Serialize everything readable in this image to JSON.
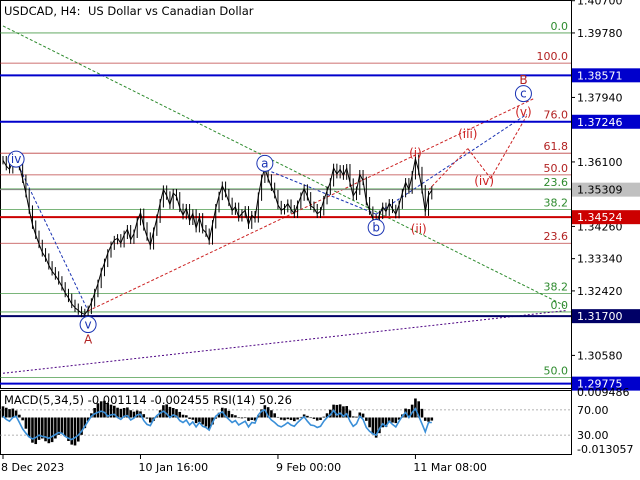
{
  "header": {
    "symbol": "USDCAD, H4:",
    "description": "US Dollar vs Canadian Dollar"
  },
  "price_axis": {
    "ticks": [
      "1.40700",
      "1.39780",
      "1.37940",
      "1.36100",
      "1.34260",
      "1.33340",
      "1.32420",
      "1.30580"
    ],
    "tick_values": [
      1.407,
      1.3978,
      1.3794,
      1.361,
      1.3426,
      1.3334,
      1.3242,
      1.3058
    ],
    "range": [
      1.2965,
      1.4072
    ]
  },
  "time_axis": {
    "labels": [
      "8 Dec 2023",
      "10 Jan 16:00",
      "9 Feb 00:00",
      "11 Mar 08:00"
    ],
    "label_bars": [
      0,
      42,
      84,
      126
    ]
  },
  "levels": [
    {
      "name": "upper-blue-level",
      "value": 1.38571,
      "label": "1.38571",
      "color": "#0000cc",
      "style": "thick"
    },
    {
      "name": "lower-blue-level-1",
      "value": 1.37246,
      "label": "1.37246",
      "color": "#0000cc",
      "style": "thick"
    },
    {
      "name": "red-level",
      "value": 1.34524,
      "label": "1.34524",
      "color": "#cc0000",
      "style": "thick"
    },
    {
      "name": "navy-level-1",
      "value": 1.317,
      "label": "1.31700",
      "color": "#000066",
      "style": "thick"
    },
    {
      "name": "navy-level-2",
      "value": 1.29775,
      "label": "1.29775",
      "color": "#0000cc",
      "style": "thick"
    },
    {
      "name": "bid-level",
      "value": 1.35309,
      "label": "1.35309",
      "color": "#888888",
      "style": "thin"
    }
  ],
  "fibo_labels": [
    {
      "text": "0.0",
      "value": 1.3978,
      "color": "#2e8b2e"
    },
    {
      "text": "100.0",
      "value": 1.3892,
      "color": "#b22222"
    },
    {
      "text": "76.0",
      "value": 1.3725,
      "color": "#b22222"
    },
    {
      "text": "61.8",
      "value": 1.3635,
      "color": "#b22222"
    },
    {
      "text": "50.0",
      "value": 1.3573,
      "color": "#b22222"
    },
    {
      "text": "23.6",
      "value": 1.3533,
      "color": "#2e8b2e"
    },
    {
      "text": "38.2",
      "value": 1.3474,
      "color": "#2e8b2e"
    },
    {
      "text": "23.6",
      "value": 1.3378,
      "color": "#b22222"
    },
    {
      "text": "38.2",
      "value": 1.3235,
      "color": "#2e8b2e"
    },
    {
      "text": "0.0",
      "value": 1.3182,
      "color": "#2e8b2e"
    },
    {
      "text": "50.0",
      "value": 1.2995,
      "color": "#2e8b2e"
    }
  ],
  "wave_labels": [
    {
      "text": "iv",
      "bar": 4,
      "value": 1.3618,
      "color": "#1a33b3",
      "circled": true
    },
    {
      "text": "v",
      "bar": 26,
      "value": 1.3146,
      "color": "#1a33b3",
      "circled": true
    },
    {
      "text": "A",
      "bar": 26,
      "value": 1.3104,
      "color": "#b22222",
      "circled": false
    },
    {
      "text": "a",
      "bar": 80,
      "value": 1.3606,
      "color": "#1a33b3",
      "circled": true
    },
    {
      "text": "b",
      "bar": 114,
      "value": 1.3423,
      "color": "#1a33b3",
      "circled": true
    },
    {
      "text": "(i)",
      "bar": 126,
      "value": 1.3635,
      "color": "#cc2222",
      "circled": false
    },
    {
      "text": "(ii)",
      "bar": 127,
      "value": 1.3418,
      "color": "#cc2222",
      "circled": false
    },
    {
      "text": "(iii)",
      "bar": 142,
      "value": 1.3689,
      "color": "#cc2222",
      "circled": false
    },
    {
      "text": "(iv)",
      "bar": 147,
      "value": 1.3556,
      "color": "#cc2222",
      "circled": false
    },
    {
      "text": "(v)",
      "bar": 159,
      "value": 1.3753,
      "color": "#cc2222",
      "circled": false
    },
    {
      "text": "B",
      "bar": 159,
      "value": 1.3844,
      "color": "#b22222",
      "circled": false
    },
    {
      "text": "c",
      "bar": 159,
      "value": 1.3805,
      "color": "#1a33b3",
      "circled": true
    }
  ],
  "chart_data": {
    "type": "line",
    "title": "USDCAD, H4: US Dollar vs Canadian Dollar",
    "xlabel": "",
    "ylabel": "",
    "grid": false,
    "x_ticks": [
      "8 Dec 2023",
      "10 Jan 16:00",
      "9 Feb 00:00",
      "11 Mar 08:00"
    ],
    "ylim": [
      1.2965,
      1.4072
    ],
    "series": [
      {
        "values": [
          1.3615,
          1.3598,
          1.3589,
          1.3612,
          1.3625,
          1.3598,
          1.3562,
          1.3521,
          1.3474,
          1.3431,
          1.3402,
          1.3376,
          1.3352,
          1.3337,
          1.3315,
          1.3298,
          1.3286,
          1.3272,
          1.3255,
          1.3236,
          1.3222,
          1.3205,
          1.3194,
          1.3186,
          1.3179,
          1.3175,
          1.3188,
          1.3209,
          1.3236,
          1.3262,
          1.3296,
          1.3322,
          1.3349,
          1.3371,
          1.3387,
          1.3392,
          1.3378,
          1.3402,
          1.3418,
          1.3388,
          1.3405,
          1.3441,
          1.3465,
          1.3426,
          1.3397,
          1.3372,
          1.3411,
          1.3448,
          1.3492,
          1.3531,
          1.3514,
          1.3488,
          1.3521,
          1.3512,
          1.3479,
          1.3458,
          1.3478,
          1.3442,
          1.3463,
          1.3421,
          1.3452,
          1.3418,
          1.3408,
          1.3386,
          1.3432,
          1.3478,
          1.3513,
          1.3542,
          1.3521,
          1.3496,
          1.3471,
          1.3482,
          1.3452,
          1.3463,
          1.3472,
          1.3431,
          1.3458,
          1.3449,
          1.3511,
          1.3562,
          1.3592,
          1.3563,
          1.3539,
          1.3518,
          1.3487,
          1.3472,
          1.3478,
          1.3491,
          1.3475,
          1.3462,
          1.3488,
          1.3511,
          1.3534,
          1.3512,
          1.3485,
          1.3478,
          1.3462,
          1.3469,
          1.3501,
          1.3528,
          1.3552,
          1.3593,
          1.3575,
          1.3589,
          1.3571,
          1.3592,
          1.3551,
          1.3513,
          1.3528,
          1.3575,
          1.3556,
          1.3498,
          1.3471,
          1.3448,
          1.3433,
          1.3459,
          1.3482,
          1.3468,
          1.3492,
          1.3476,
          1.3461,
          1.3488,
          1.3521,
          1.3552,
          1.3531,
          1.3572,
          1.3619,
          1.3584,
          1.3532,
          1.3468,
          1.3515,
          1.3529
        ]
      }
    ],
    "reference_lines": [
      {
        "value": 1.38571,
        "label": "1.38571"
      },
      {
        "value": 1.37246,
        "label": "1.37246"
      },
      {
        "value": 1.35309,
        "label": "1.35309"
      },
      {
        "value": 1.34524,
        "label": "1.34524"
      },
      {
        "value": 1.317,
        "label": "1.31700"
      },
      {
        "value": 1.29775,
        "label": "1.29775"
      }
    ]
  },
  "macd_panel": {
    "label": "MACD(5,34,5) -0.001114 -0.002455 RSI(14) 50.26",
    "ticks": [
      "0.009486",
      "70.00",
      "30.00",
      "-0.013057"
    ],
    "macd_range": [
      -0.013057,
      0.009486
    ],
    "rsi_levels": [
      70,
      30
    ],
    "histogram": [
      0.004,
      0.0035,
      0.003,
      0.0032,
      0.0025,
      0.001,
      -0.001,
      -0.004,
      -0.007,
      -0.009,
      -0.0095,
      -0.008,
      -0.0075,
      -0.0085,
      -0.0092,
      -0.0088,
      -0.0075,
      -0.0062,
      -0.0055,
      -0.0068,
      -0.0084,
      -0.0097,
      -0.01,
      -0.0086,
      -0.0062,
      -0.0038,
      -0.0012,
      0.0015,
      0.0034,
      0.0051,
      0.0058,
      0.006,
      0.0052,
      0.0046,
      0.0042,
      0.0035,
      0.0031,
      0.0034,
      0.0036,
      0.0026,
      0.0021,
      0.0025,
      0.0022,
      0.0012,
      -0.0004,
      -0.0018,
      -0.0012,
      0.0004,
      0.0026,
      0.0044,
      0.0047,
      0.0038,
      0.0034,
      0.003,
      0.002,
      0.001,
      0.0008,
      -0.0005,
      -0.0008,
      -0.002,
      -0.0016,
      -0.0025,
      -0.0032,
      -0.0041,
      -0.0025,
      -0.0004,
      0.0017,
      0.0035,
      0.0033,
      0.0024,
      0.0012,
      0.0008,
      -0.0002,
      -0.0003,
      -0.0002,
      -0.0012,
      -0.0009,
      -0.0011,
      0.0008,
      0.0029,
      0.0044,
      0.0037,
      0.0026,
      0.0015,
      0.0002,
      -0.0008,
      -0.001,
      -0.0006,
      -0.0009,
      -0.0013,
      -0.0007,
      0.0002,
      0.0011,
      0.0006,
      -0.0002,
      -0.0005,
      -0.0011,
      -0.0009,
      0.0003,
      0.0015,
      0.0028,
      0.0046,
      0.0045,
      0.0047,
      0.004,
      0.0041,
      0.0025,
      0.0004,
      0.0003,
      0.0018,
      0.0014,
      -0.0012,
      -0.0035,
      -0.006,
      -0.0072,
      -0.0056,
      -0.0035,
      -0.0034,
      -0.0018,
      -0.0018,
      -0.002,
      -0.0008,
      0.0011,
      0.0032,
      0.003,
      0.0046,
      0.0068,
      0.0058,
      0.0031,
      -0.0012,
      -0.0015,
      -0.0011
    ],
    "rsi": [
      60,
      55,
      52,
      58,
      60,
      50,
      40,
      33,
      27,
      24,
      26,
      30,
      28,
      27,
      25,
      28,
      31,
      34,
      33,
      28,
      25,
      23,
      26,
      30,
      36,
      44,
      52,
      60,
      64,
      66,
      68,
      66,
      60,
      62,
      63,
      58,
      55,
      60,
      61,
      54,
      57,
      62,
      63,
      53,
      47,
      45,
      55,
      61,
      65,
      68,
      64,
      58,
      62,
      60,
      53,
      50,
      54,
      46,
      51,
      43,
      50,
      44,
      42,
      38,
      50,
      60,
      64,
      67,
      60,
      55,
      50,
      53,
      46,
      49,
      52,
      43,
      50,
      49,
      62,
      68,
      70,
      60,
      54,
      50,
      45,
      43,
      46,
      50,
      46,
      44,
      50,
      55,
      59,
      52,
      46,
      45,
      42,
      44,
      52,
      58,
      62,
      69,
      62,
      65,
      60,
      64,
      52,
      44,
      48,
      60,
      55,
      42,
      36,
      32,
      30,
      40,
      48,
      44,
      52,
      47,
      43,
      52,
      60,
      66,
      58,
      66,
      72,
      60,
      48,
      35,
      50,
      50
    ]
  },
  "colors": {
    "candles": "#000000",
    "macd_histogram": "#000000",
    "rsi_line": "#3a8fd8",
    "fibo_green": "#2e8b2e",
    "fibo_red": "#b22222",
    "label_bg": "#0000cc"
  }
}
